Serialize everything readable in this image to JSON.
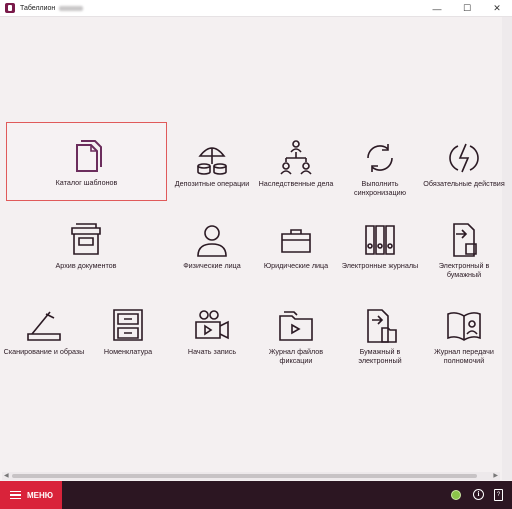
{
  "window": {
    "title": "Табеллион",
    "minimize_glyph": "—",
    "maximize_glyph": "☐",
    "close_glyph": "✕"
  },
  "tiles": [
    {
      "label": "Каталог шаблонов",
      "icon": "documents-icon",
      "selected": true
    },
    {
      "label": "Депозитные операции",
      "icon": "coins-umbrella-icon"
    },
    {
      "label": "Наследственные дела",
      "icon": "family-tree-icon"
    },
    {
      "label": "Выполнить синхронизацию",
      "icon": "sync-icon"
    },
    {
      "label": "Обязательные действия",
      "icon": "lightning-icon"
    },
    {
      "label": "Архив документов",
      "icon": "archive-box-icon"
    },
    {
      "label": "Физические лица",
      "icon": "person-icon"
    },
    {
      "label": "Юридические лица",
      "icon": "briefcase-icon"
    },
    {
      "label": "Электронные журналы",
      "icon": "binders-icon"
    },
    {
      "label": "Электронный в бумажный",
      "icon": "file-export-icon"
    },
    {
      "label": "Сканирование и образы",
      "icon": "scanner-icon"
    },
    {
      "label": "Номенклатура",
      "icon": "cabinet-icon"
    },
    {
      "label": "Начать запись",
      "icon": "video-camera-icon"
    },
    {
      "label": "Журнал файлов фиксации",
      "icon": "video-folder-icon"
    },
    {
      "label": "Бумажный в электронный",
      "icon": "file-import-icon"
    },
    {
      "label": "Журнал передачи полномочий",
      "icon": "book-person-icon"
    }
  ],
  "bottombar": {
    "menu_label": "МЕНЮ",
    "info_glyph": "i",
    "help_glyph": "?",
    "status_color": "#8bc34a"
  },
  "colors": {
    "accent": "#d9233a",
    "bottombar": "#2c1622",
    "selection_border": "#e05a5a"
  }
}
